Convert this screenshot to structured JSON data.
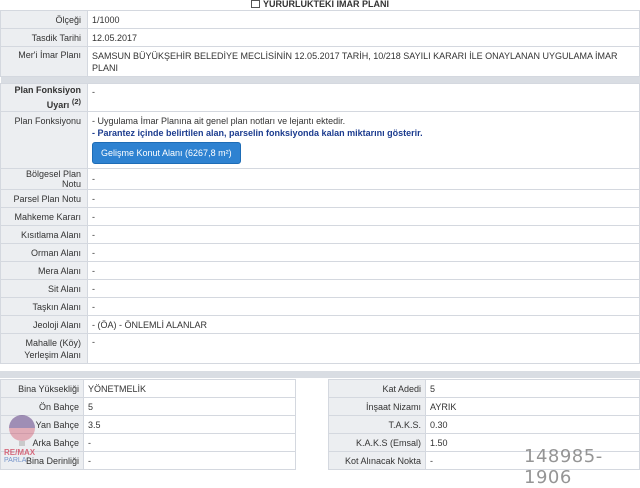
{
  "header": {
    "title": "YÜRÜRLÜKTEKİ İMAR PLANI"
  },
  "rows": {
    "olcegi": {
      "label": "Ölçeği",
      "value": "1/1000"
    },
    "tasdik": {
      "label": "Tasdik Tarihi",
      "value": "12.05.2017"
    },
    "merii": {
      "label": "Mer'i İmar Planı",
      "value": "SAMSUN BÜYÜKŞEHİR BELEDİYE MECLİSİNİN 12.05.2017 TARİH, 10/218 SAYILI KARARI İLE ONAYLANAN UYGULAMA İMAR PLANI"
    },
    "uyari": {
      "label_line1": "Plan Fonksiyon",
      "label_line2": "Uyarı",
      "label_sup": "(2)",
      "value": "-"
    },
    "fonksiyon": {
      "label": "Plan Fonksiyonu",
      "note1": "- Uygulama İmar Planına ait genel plan notları ve lejantı ektedir.",
      "note2": "- Parantez içinde belirtilen alan, parselin fonksiyonda kalan miktarını gösterir.",
      "button": "Gelişme Konut Alanı (6267,8 m²)"
    },
    "bolgesel": {
      "label": "Bölgesel Plan Notu",
      "value": "-"
    },
    "parsel": {
      "label": "Parsel Plan Notu",
      "value": "-"
    },
    "mahkeme": {
      "label": "Mahkeme Kararı",
      "value": "-"
    },
    "kisitlama": {
      "label": "Kısıtlama Alanı",
      "value": "-"
    },
    "orman": {
      "label": "Orman Alanı",
      "value": "-"
    },
    "mera": {
      "label": "Mera Alanı",
      "value": "-"
    },
    "sit": {
      "label": "Sit Alanı",
      "value": "-"
    },
    "taskin": {
      "label": "Taşkın Alanı",
      "value": "-"
    },
    "jeoloji": {
      "label": "Jeoloji Alanı",
      "value": "- (ÖA) - ÖNLEMLİ ALANLAR"
    },
    "mahalle": {
      "label_line1": "Mahalle (Köy)",
      "label_line2": "Yerleşim Alanı",
      "value": "-"
    }
  },
  "left_table": [
    {
      "label": "Bina Yüksekliği",
      "value": "YÖNETMELİK"
    },
    {
      "label": "Ön Bahçe",
      "value": "5"
    },
    {
      "label": "Yan Bahçe",
      "value": "3.5"
    },
    {
      "label": "Arka Bahçe",
      "value": "-"
    },
    {
      "label": "Bina Derinliği",
      "value": "-"
    }
  ],
  "right_table": [
    {
      "label": "Kat Adedi",
      "value": "5"
    },
    {
      "label": "İnşaat Nizamı",
      "value": "AYRIK"
    },
    {
      "label": "T.A.K.S.",
      "value": "0.30"
    },
    {
      "label": "K.A.K.S (Emsal)",
      "value": "1.50"
    },
    {
      "label": "Kot Alınacak Nokta",
      "value": "-"
    }
  ],
  "logo": {
    "text1": "RE/MAX",
    "text2": "PARLA"
  },
  "watermark": {
    "text": "148985-1906"
  }
}
